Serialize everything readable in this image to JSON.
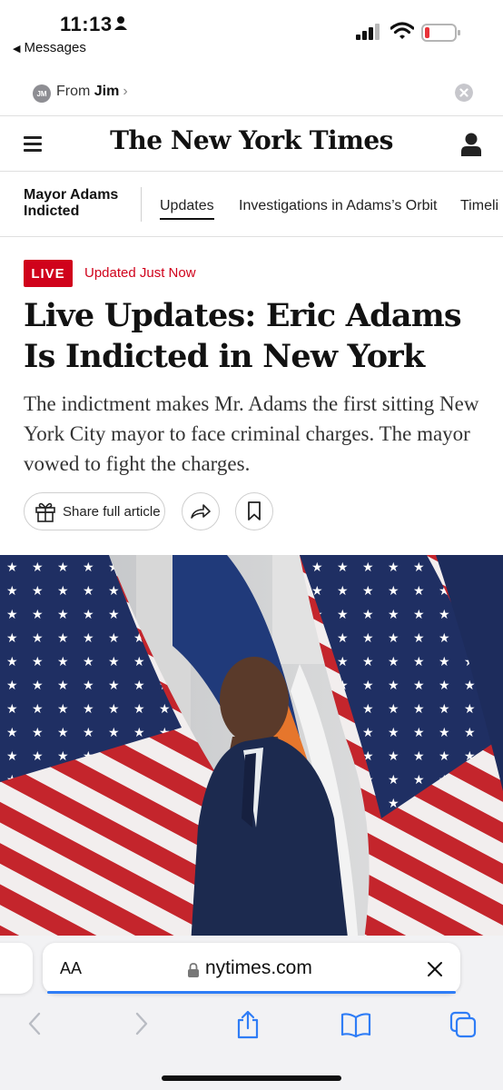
{
  "status_bar": {
    "time": "11:13",
    "back_app": "Messages"
  },
  "banner": {
    "initials": "JM",
    "from_prefix": "From",
    "from_name": "Jim"
  },
  "masthead": {
    "title": "The New York Times"
  },
  "nav": {
    "title": "Mayor Adams Indicted",
    "tabs": [
      {
        "label": "Updates",
        "active": true
      },
      {
        "label": "Investigations in Adams’s Orbit",
        "active": false
      },
      {
        "label": "Timeli",
        "active": false
      }
    ]
  },
  "article": {
    "live_badge": "LIVE",
    "updated": "Updated Just Now",
    "headline": "Live Updates: Eric Adams Is Indicted in New York",
    "summary": "The indictment makes Mr. Adams the first sitting New York City mayor to face criminal charges. The mayor vowed to fight the charges.",
    "share_label": "Share full article"
  },
  "browser": {
    "text_size": "AA",
    "url": "nytimes.com"
  },
  "colors": {
    "live_red": "#d0021b",
    "safari_blue": "#2f7df6",
    "flag_blue": "#1f2f63",
    "flag_red": "#c4252c"
  }
}
